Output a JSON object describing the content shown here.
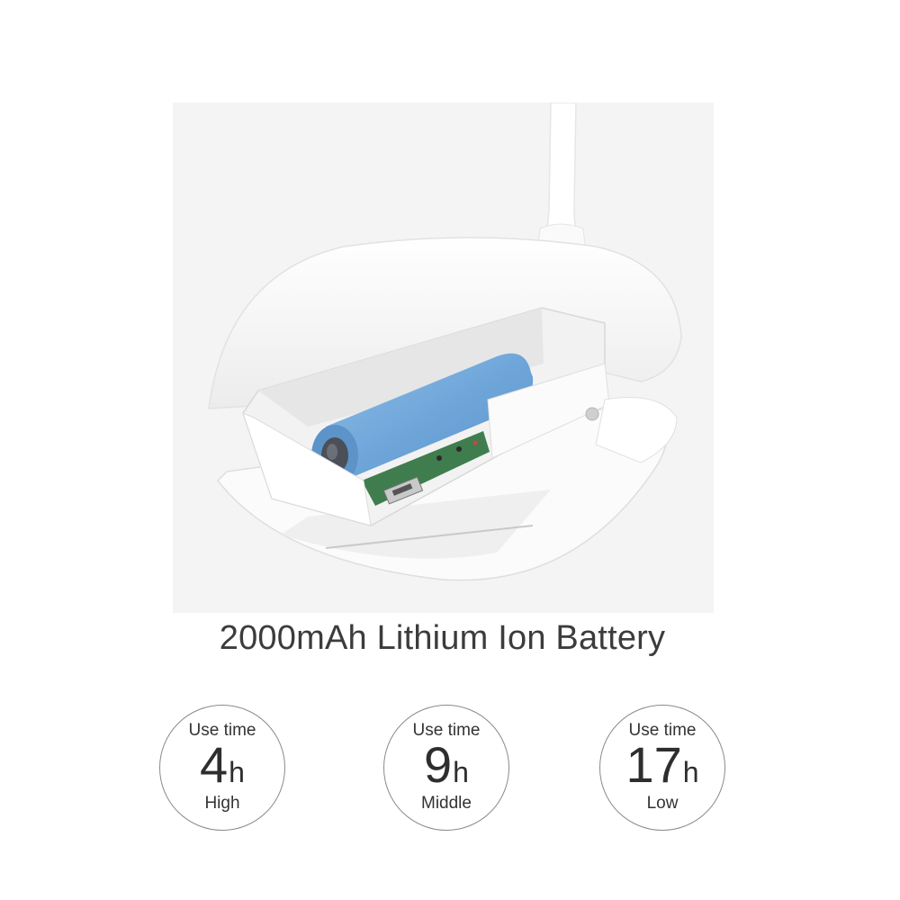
{
  "headline": "2000mAh Lithium Ion Battery",
  "modes": [
    {
      "caption": "Use time",
      "value": "4",
      "unit": "h",
      "level": "High"
    },
    {
      "caption": "Use time",
      "value": "9",
      "unit": "h",
      "level": "Middle"
    },
    {
      "caption": "Use time",
      "value": "17",
      "unit": "h",
      "level": "Low"
    }
  ],
  "colors": {
    "battery": "#6fa6da",
    "circuit_board": "#3f7d4e",
    "housing": "#ffffff",
    "photo_background": "#f4f4f4"
  }
}
